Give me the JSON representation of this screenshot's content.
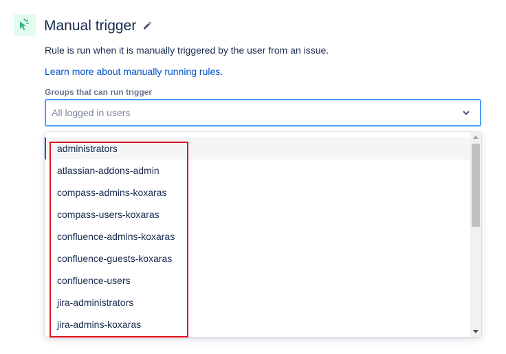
{
  "header": {
    "icon": "cursor-click-icon",
    "title": "Manual trigger",
    "edit_icon": "pencil-icon"
  },
  "description": "Rule is run when it is manually triggered by the user from an issue.",
  "learn_more_link": "Learn more about manually running rules.",
  "groups_field": {
    "label": "Groups that can run trigger",
    "placeholder": "All logged in users",
    "dropdown_icon": "chevron-down-icon"
  },
  "dropdown": {
    "options": [
      "administrators",
      "atlassian-addons-admin",
      "compass-admins-koxaras",
      "compass-users-koxaras",
      "confluence-admins-koxaras",
      "confluence-guests-koxaras",
      "confluence-users",
      "jira-administrators",
      "jira-admins-koxaras"
    ],
    "focused_index": 0
  },
  "colors": {
    "accent": "#0052cc",
    "focus_border": "#4c9aff",
    "icon_bg": "#e3fcef",
    "icon_fg": "#36b37e",
    "annotation": "#e0121e"
  }
}
